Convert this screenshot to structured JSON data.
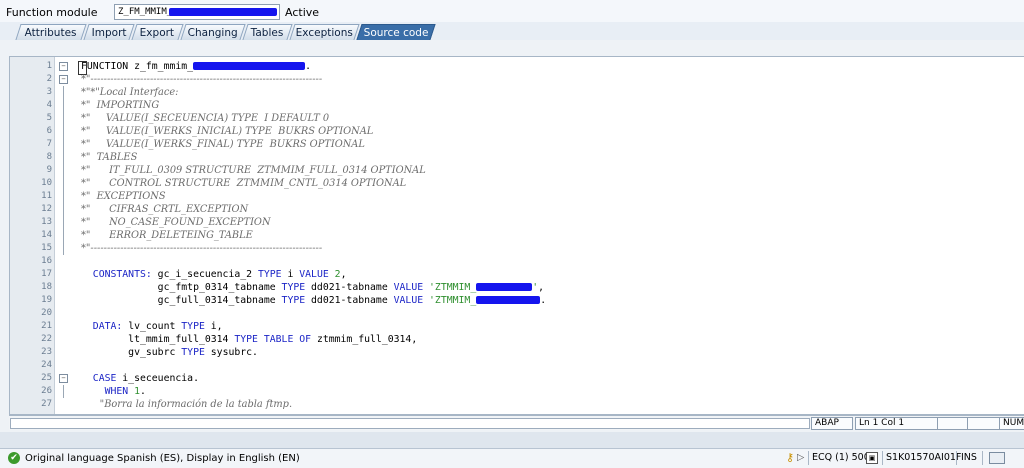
{
  "header": {
    "function_module_label": "Function module",
    "function_module_value": "Z_FM_MMIM_",
    "status": "Active"
  },
  "tabs": [
    {
      "label": "Attributes",
      "active": false
    },
    {
      "label": "Import",
      "active": false
    },
    {
      "label": "Export",
      "active": false
    },
    {
      "label": "Changing",
      "active": false
    },
    {
      "label": "Tables",
      "active": false
    },
    {
      "label": "Exceptions",
      "active": false
    },
    {
      "label": "Source code",
      "active": true
    }
  ],
  "code_lines": [
    {
      "n": "1",
      "fold": "box",
      "parts": [
        {
          "t": "FUNCTION z_fm_mmim_",
          "c": "kwfirst"
        },
        {
          "t": "",
          "c": "redact",
          "w": 112
        },
        {
          "t": ".",
          "c": ""
        }
      ]
    },
    {
      "n": "2",
      "fold": "box",
      "parts": [
        {
          "t": "*\"----------------------------------------------------------------------",
          "c": "comment"
        }
      ]
    },
    {
      "n": "3",
      "parts": [
        {
          "t": "*\"*\"Local Interface:",
          "c": "comment"
        }
      ]
    },
    {
      "n": "4",
      "parts": [
        {
          "t": "*\"  IMPORTING",
          "c": "comment"
        }
      ]
    },
    {
      "n": "5",
      "parts": [
        {
          "t": "*\"     VALUE(I_SECEUENCIA) TYPE  I DEFAULT 0",
          "c": "comment"
        }
      ]
    },
    {
      "n": "6",
      "parts": [
        {
          "t": "*\"     VALUE(I_WERKS_INICIAL) TYPE  BUKRS OPTIONAL",
          "c": "comment"
        }
      ]
    },
    {
      "n": "7",
      "parts": [
        {
          "t": "*\"     VALUE(I_WERKS_FINAL) TYPE  BUKRS OPTIONAL",
          "c": "comment"
        }
      ]
    },
    {
      "n": "8",
      "parts": [
        {
          "t": "*\"  TABLES",
          "c": "comment"
        }
      ]
    },
    {
      "n": "9",
      "parts": [
        {
          "t": "*\"      IT_FULL_0309 STRUCTURE  ZTMMIM_FULL_0314 OPTIONAL",
          "c": "comment"
        }
      ]
    },
    {
      "n": "10",
      "parts": [
        {
          "t": "*\"      CONTROL STRUCTURE  ZTMMIM_CNTL_0314 OPTIONAL",
          "c": "comment"
        }
      ]
    },
    {
      "n": "11",
      "parts": [
        {
          "t": "*\"  EXCEPTIONS",
          "c": "comment"
        }
      ]
    },
    {
      "n": "12",
      "parts": [
        {
          "t": "*\"      CIFRAS_CRTL_EXCEPTION",
          "c": "comment"
        }
      ]
    },
    {
      "n": "13",
      "parts": [
        {
          "t": "*\"      NO_CASE_FOUND_EXCEPTION",
          "c": "comment"
        }
      ]
    },
    {
      "n": "14",
      "parts": [
        {
          "t": "*\"      ERROR_DELETEING_TABLE",
          "c": "comment"
        }
      ]
    },
    {
      "n": "15",
      "fold": "end",
      "parts": [
        {
          "t": "*\"----------------------------------------------------------------------",
          "c": "comment"
        }
      ]
    },
    {
      "n": "16",
      "parts": []
    },
    {
      "n": "17",
      "parts": [
        {
          "t": "  ",
          "c": ""
        },
        {
          "t": "CONSTANTS:",
          "c": "kw"
        },
        {
          "t": " gc_i_secuencia_2 ",
          "c": ""
        },
        {
          "t": "TYPE",
          "c": "kw"
        },
        {
          "t": " i ",
          "c": ""
        },
        {
          "t": "VALUE",
          "c": "kw"
        },
        {
          "t": " ",
          "c": ""
        },
        {
          "t": "2",
          "c": "num"
        },
        {
          "t": ",",
          "c": ""
        }
      ]
    },
    {
      "n": "18",
      "parts": [
        {
          "t": "             gc_fmtp_0314_tabname ",
          "c": ""
        },
        {
          "t": "TYPE",
          "c": "kw"
        },
        {
          "t": " dd021-tabname ",
          "c": ""
        },
        {
          "t": "VALUE",
          "c": "kw"
        },
        {
          "t": " ",
          "c": ""
        },
        {
          "t": "'ZTMMIM_",
          "c": "str"
        },
        {
          "t": "",
          "c": "redact",
          "w": 56
        },
        {
          "t": "'",
          "c": "str"
        },
        {
          "t": ",",
          "c": ""
        }
      ]
    },
    {
      "n": "19",
      "parts": [
        {
          "t": "             gc_full_0314_tabname ",
          "c": ""
        },
        {
          "t": "TYPE",
          "c": "kw"
        },
        {
          "t": " dd021-tabname ",
          "c": ""
        },
        {
          "t": "VALUE",
          "c": "kw"
        },
        {
          "t": " ",
          "c": ""
        },
        {
          "t": "'ZTMMIM_",
          "c": "str"
        },
        {
          "t": "",
          "c": "redact",
          "w": 64
        },
        {
          "t": ".",
          "c": ""
        }
      ]
    },
    {
      "n": "20",
      "parts": []
    },
    {
      "n": "21",
      "parts": [
        {
          "t": "  ",
          "c": ""
        },
        {
          "t": "DATA:",
          "c": "kw"
        },
        {
          "t": " lv_count ",
          "c": ""
        },
        {
          "t": "TYPE",
          "c": "kw"
        },
        {
          "t": " i,",
          "c": ""
        }
      ]
    },
    {
      "n": "22",
      "parts": [
        {
          "t": "        lt_mmim_full_0314 ",
          "c": ""
        },
        {
          "t": "TYPE TABLE OF",
          "c": "kw"
        },
        {
          "t": " ztmmim_full_0314,",
          "c": ""
        }
      ]
    },
    {
      "n": "23",
      "parts": [
        {
          "t": "        gv_subrc ",
          "c": ""
        },
        {
          "t": "TYPE",
          "c": "kw"
        },
        {
          "t": " sysubrc.",
          "c": ""
        }
      ]
    },
    {
      "n": "24",
      "parts": []
    },
    {
      "n": "25",
      "fold": "box",
      "parts": [
        {
          "t": "  ",
          "c": ""
        },
        {
          "t": "CASE",
          "c": "kw"
        },
        {
          "t": " i_seceuencia.",
          "c": ""
        }
      ]
    },
    {
      "n": "26",
      "fold": "dot",
      "parts": [
        {
          "t": "    ",
          "c": ""
        },
        {
          "t": "WHEN",
          "c": "kw"
        },
        {
          "t": " ",
          "c": ""
        },
        {
          "t": "1",
          "c": "num"
        },
        {
          "t": ".",
          "c": ""
        }
      ]
    },
    {
      "n": "27",
      "parts": [
        {
          "t": "      \"Borra la información de la tabla ftmp.",
          "c": "comment"
        }
      ]
    }
  ],
  "editor_status": {
    "language": "ABAP",
    "position": "Ln  1 Col  1",
    "mode": "NUM"
  },
  "status_bar": {
    "message": "Original language Spanish (ES), Display in English (EN)",
    "system": "ECQ (1) 500",
    "transport": "S1K01570AI01F",
    "insert_mode": "INS"
  }
}
